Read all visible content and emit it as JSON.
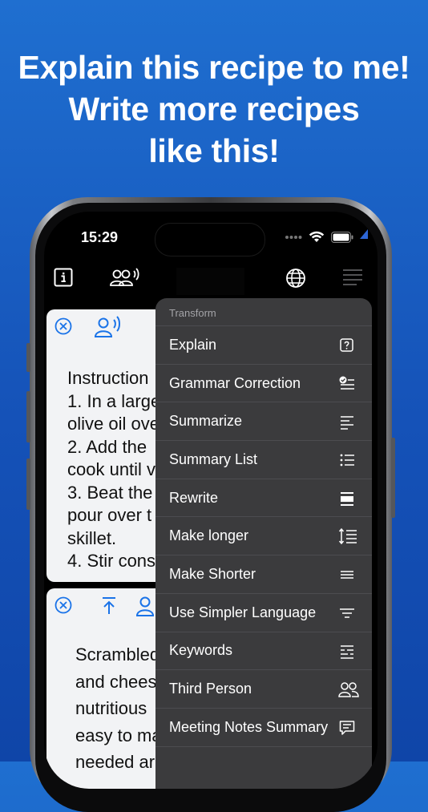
{
  "headline": {
    "line1": "Explain this recipe to me!",
    "line2": "Write more recipes",
    "line3": "like this!"
  },
  "status_bar": {
    "time": "15:29"
  },
  "toolbar": {
    "info_icon": "info-icon",
    "speak_icon": "group-speak-icon",
    "globe_icon": "globe-icon",
    "menu_icon": "text-lines-icon"
  },
  "cards": [
    {
      "text": "Instruction\n1. In a large\nolive oil ove\n2. Add the\ncook until v\n3. Beat the\npour over t\nskillet.\n4. Stir cons"
    },
    {
      "text": "Scrambled\nand chees\nnutritious\neasy to ma\nneeded ar"
    }
  ],
  "menu": {
    "header": "Transform",
    "items": [
      {
        "label": "Explain",
        "icon": "question-square-icon"
      },
      {
        "label": "Grammar Correction",
        "icon": "checklist-icon"
      },
      {
        "label": "Summarize",
        "icon": "text-align-left-icon"
      },
      {
        "label": "Summary List",
        "icon": "bullet-list-icon"
      },
      {
        "label": "Rewrite",
        "icon": "text-justify-icon"
      },
      {
        "label": "Make longer",
        "icon": "line-height-icon"
      },
      {
        "label": "Make Shorter",
        "icon": "short-lines-icon"
      },
      {
        "label": "Use Simpler Language",
        "icon": "text-center-icon"
      },
      {
        "label": "Keywords",
        "icon": "keyword-lines-icon"
      },
      {
        "label": "Third Person",
        "icon": "two-people-icon"
      },
      {
        "label": "Meeting Notes Summary",
        "icon": "speech-bubble-lines-icon"
      }
    ]
  }
}
